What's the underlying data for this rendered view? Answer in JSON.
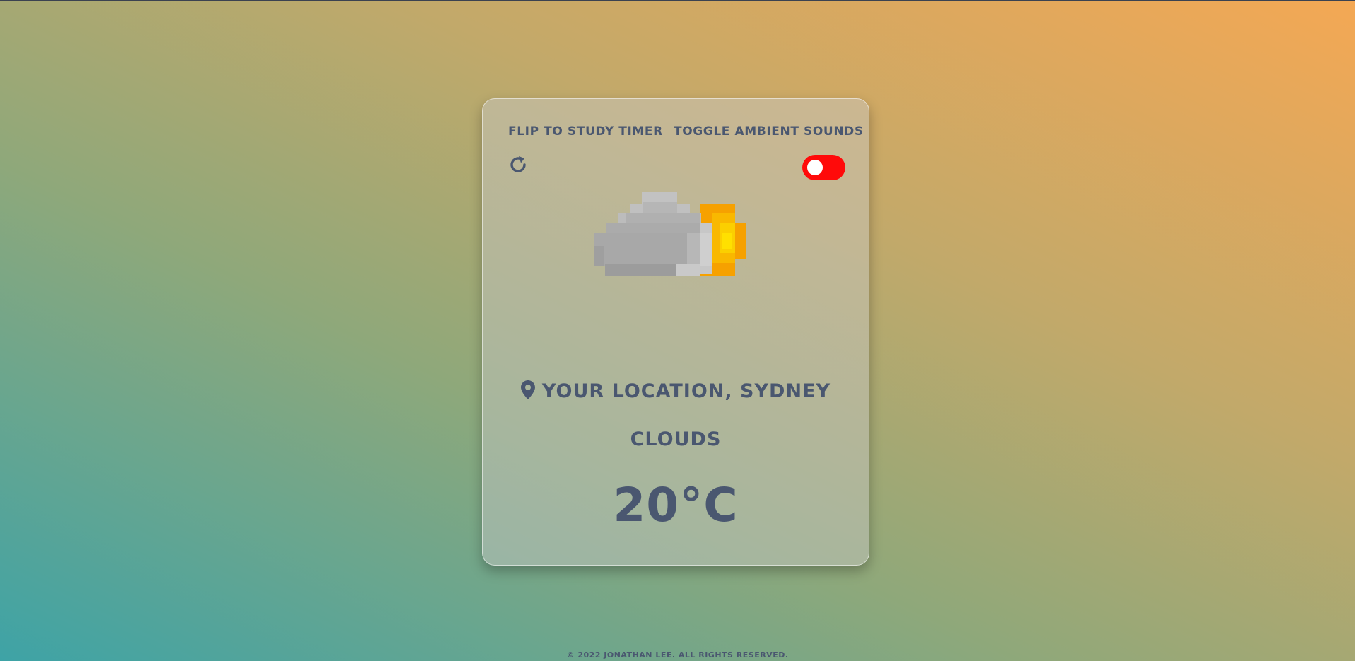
{
  "header": {
    "flip_label": "Flip to Study Timer",
    "ambient_label": "Toggle Ambient Sounds"
  },
  "controls": {
    "ambient_sounds_enabled": false,
    "toggle_color": "#ff0a0a",
    "refresh_icon": "refresh-icon"
  },
  "weather": {
    "icon": "cloud-sun-icon",
    "location": "Your Location, Sydney",
    "condition": "Clouds",
    "temperature": "20°C"
  },
  "footer": {
    "copyright": "© 2022 Jonathan Lee. All rights reserved."
  },
  "colors": {
    "text": "#4a5770",
    "cloud": "#a8a8a8",
    "sun": "#f6a100"
  }
}
